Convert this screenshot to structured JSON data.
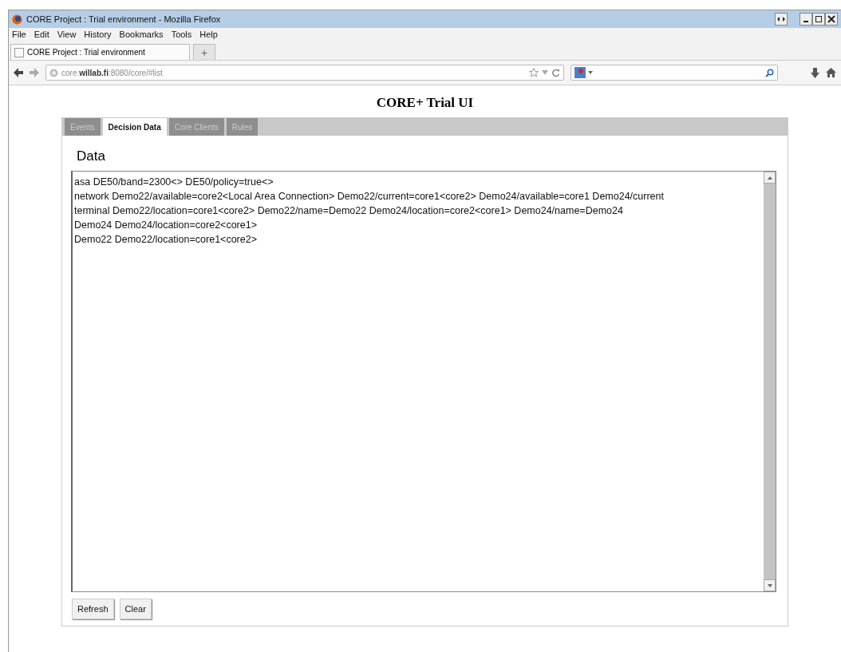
{
  "window": {
    "title": "CORE Project : Trial environment - Mozilla Firefox"
  },
  "menu": [
    "File",
    "Edit",
    "View",
    "History",
    "Bookmarks",
    "Tools",
    "Help"
  ],
  "browser_tabs": [
    {
      "label": "CORE Project : Trial environment",
      "selected": true
    }
  ],
  "new_tab": "+",
  "address_bar": {
    "host": "core.",
    "domain": "willab.fi",
    "rest": ":8080/core/#list"
  },
  "page": {
    "title": "CORE+ Trial UI",
    "tabs": [
      {
        "label": "Events",
        "selected": false
      },
      {
        "label": "Decision Data",
        "selected": true
      },
      {
        "label": "Core Clients",
        "selected": false
      },
      {
        "label": "Rules",
        "selected": false
      }
    ],
    "heading": "Data",
    "data_lines": [
      "asa DE50/band=2300<> DE50/policy=true<>",
      "network Demo22/available=core2<Local Area Connection> Demo22/current=core1<core2> Demo24/available=core1 Demo24/current",
      "terminal Demo22/location=core1<core2> Demo22/name=Demo22 Demo24/location=core2<core1> Demo24/name=Demo24",
      "Demo24 Demo24/location=core2<core1>",
      "Demo22 Demo22/location=core1<core2>"
    ],
    "buttons": [
      "Refresh",
      "Clear"
    ]
  }
}
